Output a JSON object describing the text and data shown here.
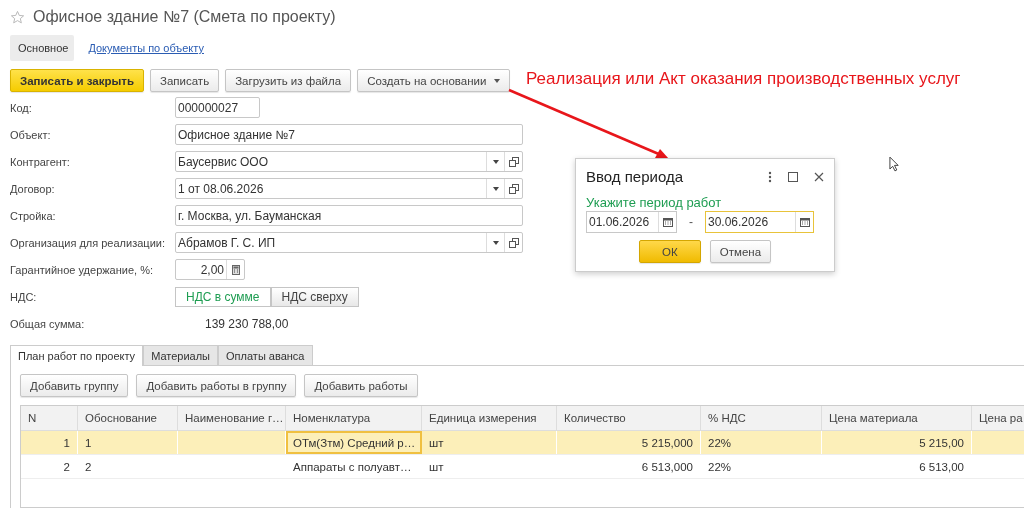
{
  "window": {
    "title": "Офисное здание №7 (Смета по проекту)"
  },
  "nav": [
    {
      "label": "Основное",
      "selected": true
    },
    {
      "label": "Документы по объекту",
      "selected": false
    }
  ],
  "toolbar": [
    {
      "label": "Записать и закрыть",
      "kind": "primary"
    },
    {
      "label": "Записать",
      "kind": "plain"
    },
    {
      "label": "Загрузить из файла",
      "kind": "plain"
    },
    {
      "label": "Создать на основании",
      "kind": "menu"
    }
  ],
  "annotation": {
    "text": "Реализация или Акт оказания производственных услуг"
  },
  "fields": [
    {
      "label": "Код:",
      "kind": "short",
      "value": "000000027"
    },
    {
      "label": "Объект:",
      "kind": "text",
      "value": "Офисное здание №7"
    },
    {
      "label": "Контрагент:",
      "kind": "select",
      "value": "Баусервис ООО"
    },
    {
      "label": "Договор:",
      "kind": "select",
      "value": "1 от 08.06.2026"
    },
    {
      "label": "Стройка:",
      "kind": "text",
      "value": "г. Москва, ул. Бауманская"
    },
    {
      "label": "Организация для реализации:",
      "kind": "select",
      "value": "Абрамов Г. С. ИП"
    },
    {
      "label": "Гарантийное удержание, %:",
      "kind": "number",
      "value": "2,00"
    },
    {
      "label": "НДС:",
      "kind": "toggle",
      "options": [
        {
          "label": "НДС в сумме",
          "selected": true
        },
        {
          "label": "НДС сверху",
          "selected": false
        }
      ]
    },
    {
      "label": "Общая сумма:",
      "kind": "readonly",
      "value": "139 230 788,00"
    }
  ],
  "tabs": [
    {
      "label": "План работ по проекту",
      "selected": true
    },
    {
      "label": "Материалы",
      "selected": false
    },
    {
      "label": "Оплаты аванса",
      "selected": false
    }
  ],
  "table_buttons": [
    "Добавить группу",
    "Добавить работы в группу",
    "Добавить работы"
  ],
  "table": {
    "columns": [
      "N",
      "Обоснование",
      "Наименование г…",
      "Номенклатура",
      "Единица измерения",
      "Количество",
      "% НДС",
      "Цена материала",
      "Цена ра"
    ],
    "rows": [
      {
        "selected": true,
        "nomenclature_focused": true,
        "n": "1",
        "basis": "1",
        "nomenclature": "ОТм(Зтм) Средний р…",
        "unit": "шт",
        "quantity": "5 215,000",
        "vat": "22%",
        "material_price": "5 215,00"
      },
      {
        "selected": false,
        "nomenclature_focused": false,
        "n": "2",
        "basis": "2",
        "nomenclature": "Аппараты с полуавт…",
        "unit": "шт",
        "quantity": "6 513,000",
        "vat": "22%",
        "material_price": "6 513,00"
      }
    ]
  },
  "dialog": {
    "title": "Ввод периода",
    "hint": "Укажите период работ",
    "date_from": {
      "value": "01.06.2026",
      "focused": false
    },
    "separator": "-",
    "date_to": {
      "value": "30.06.2026",
      "focused": true
    },
    "buttons": [
      {
        "label": "ОК",
        "kind": "default"
      },
      {
        "label": "Отмена",
        "kind": "plain"
      }
    ]
  }
}
